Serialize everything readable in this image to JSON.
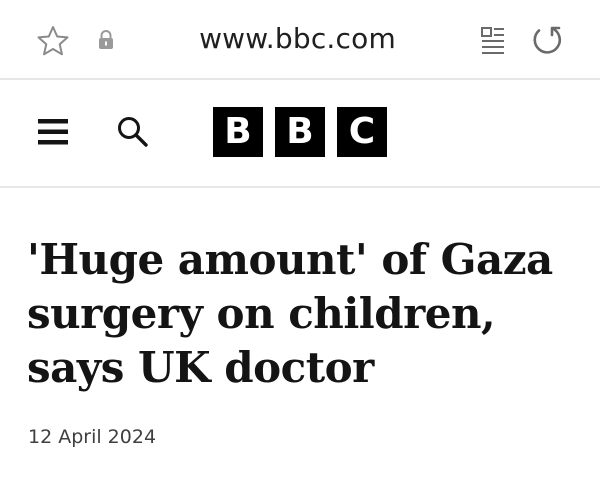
{
  "browser": {
    "url": "www.bbc.com",
    "icons": {
      "favorite": "star-icon",
      "security": "lock-icon",
      "reader_mode": "reader-view-icon",
      "reload": "reload-icon"
    }
  },
  "site_header": {
    "icons": {
      "menu": "hamburger-menu-icon",
      "search": "search-icon"
    },
    "logo_letters": [
      "B",
      "B",
      "C"
    ],
    "logo_color": "#000000"
  },
  "article": {
    "headline": "'Huge amount' of Gaza surgery on children, says UK doctor",
    "date": "12 April 2024"
  }
}
